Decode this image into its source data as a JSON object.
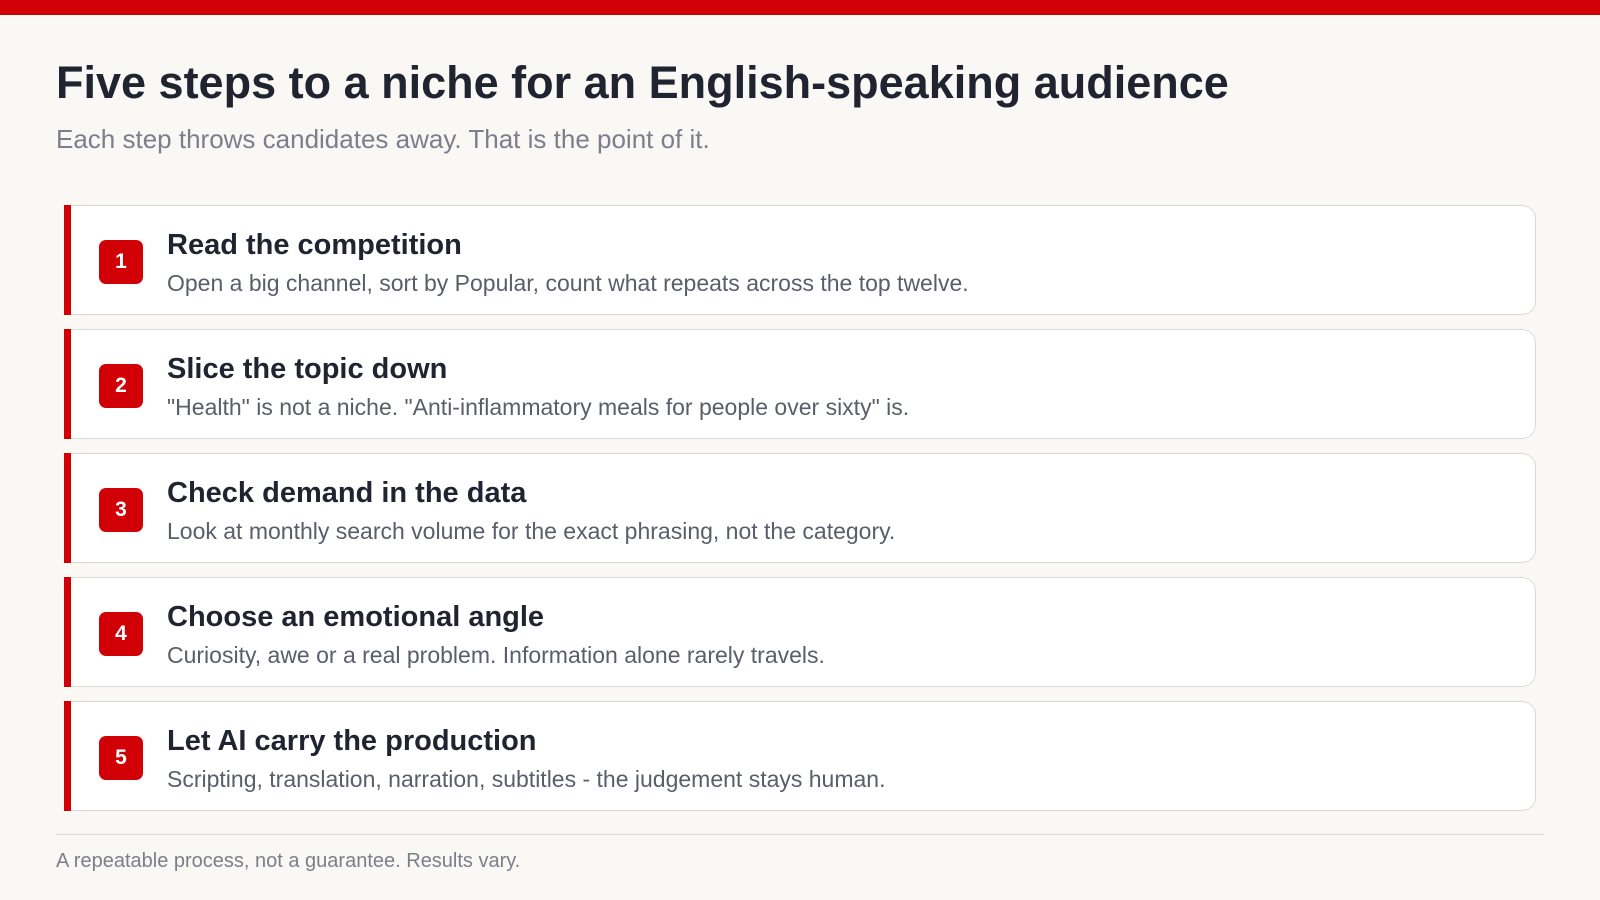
{
  "header": {
    "title": "Five steps to a niche for an English-speaking audience",
    "subtitle": "Each step throws candidates away. That is the point of it."
  },
  "steps": [
    {
      "number": "1",
      "title": "Read the competition",
      "description": "Open a big channel, sort by Popular, count what repeats across the top twelve."
    },
    {
      "number": "2",
      "title": "Slice the topic down",
      "description": "\"Health\" is not a niche. \"Anti-inflammatory meals for people over sixty\" is."
    },
    {
      "number": "3",
      "title": "Check demand in the data",
      "description": "Look at monthly search volume for the exact phrasing, not the category."
    },
    {
      "number": "4",
      "title": "Choose an emotional angle",
      "description": "Curiosity, awe or a real problem. Information alone rarely travels."
    },
    {
      "number": "5",
      "title": "Let AI carry the production",
      "description": "Scripting, translation, narration, subtitles - the judgement stays human."
    }
  ],
  "footer": {
    "note": "A repeatable process, not a guarantee. Results vary."
  },
  "colors": {
    "accent": "#d10006",
    "background": "#f9f8f5",
    "card": "#ffffff",
    "title_text": "#1f2430",
    "muted_text": "#7a7f89"
  }
}
